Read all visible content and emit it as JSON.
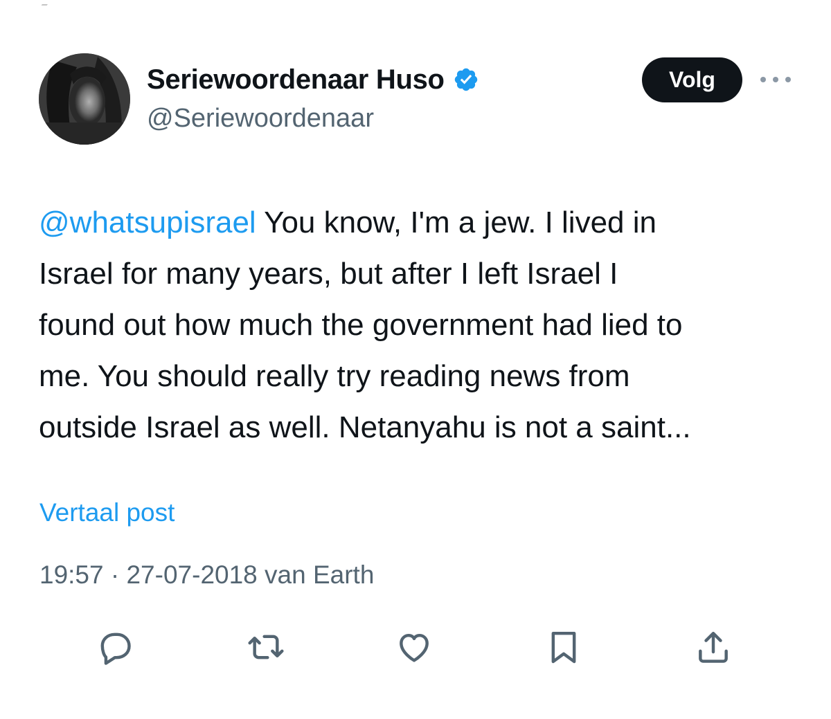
{
  "author": {
    "display_name": "Seriewoordenaar Huso",
    "handle": "@Seriewoordenaar",
    "verified": true
  },
  "follow_button": {
    "label": "Volg"
  },
  "post": {
    "mention": "@whatsupisrael",
    "lines": [
      " You know, I'm a jew. I lived in",
      "Israel for many years, but after I left Israel I",
      "found out how much the government had lied to",
      "me. You should really try reading news from",
      "outside Israel as well. Netanyahu is not a saint..."
    ]
  },
  "translate_link": "Vertaal post",
  "meta": {
    "time": "19:57",
    "separator": " · ",
    "date_source": "27-07-2018 van Earth"
  },
  "actions": [
    {
      "name": "reply",
      "icon": "reply-icon"
    },
    {
      "name": "repost",
      "icon": "repost-icon"
    },
    {
      "name": "like",
      "icon": "heart-icon"
    },
    {
      "name": "bookmark",
      "icon": "bookmark-icon"
    },
    {
      "name": "share",
      "icon": "share-icon"
    }
  ],
  "colors": {
    "text": "#0f1419",
    "secondary": "#536471",
    "link": "#1d9bf0",
    "verified": "#1d9bf0",
    "button_bg": "#0f1419"
  }
}
